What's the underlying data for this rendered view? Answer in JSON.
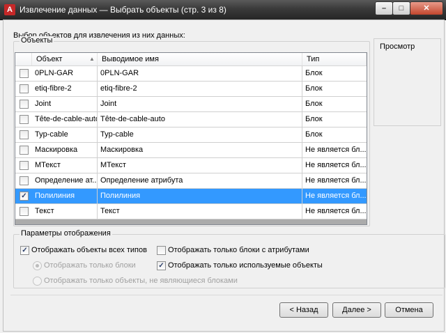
{
  "window": {
    "title": "Извлечение данных — Выбрать объекты (стр. 3 из 8)",
    "app_icon_letter": "A",
    "controls": {
      "minimize": "–",
      "maximize": "□",
      "close": "✕"
    }
  },
  "select_label": "Выбор объектов для извлечения из них данных:",
  "objects_group": "Объекты",
  "preview_label": "Просмотр",
  "table": {
    "columns": [
      "Объект",
      "Выводимое имя",
      "Тип"
    ],
    "sort_indicator": "▲",
    "rows": [
      {
        "checked": false,
        "object": "0PLN-GAR",
        "display": "0PLN-GAR",
        "type": "Блок"
      },
      {
        "checked": false,
        "object": "etiq-fibre-2",
        "display": "etiq-fibre-2",
        "type": "Блок"
      },
      {
        "checked": false,
        "object": "Joint",
        "display": "Joint",
        "type": "Блок"
      },
      {
        "checked": false,
        "object": "Tête-de-cable-auto",
        "display": "Tête-de-cable-auto",
        "type": "Блок"
      },
      {
        "checked": false,
        "object": "Typ-cable",
        "display": "Typ-cable",
        "type": "Блок"
      },
      {
        "checked": false,
        "object": "Маскировка",
        "display": "Маскировка",
        "type": "Не является бл..."
      },
      {
        "checked": false,
        "object": "МТекст",
        "display": "МТекст",
        "type": "Не является бл..."
      },
      {
        "checked": false,
        "object": "Определение ат...",
        "display": "Определение атрибута",
        "type": "Не является бл..."
      },
      {
        "checked": true,
        "selected": true,
        "object": "Полилиния",
        "display": "Полилиния",
        "type": "Не является бл..."
      },
      {
        "checked": false,
        "object": "Текст",
        "display": "Текст",
        "type": "Не является бл..."
      }
    ]
  },
  "display_options": {
    "title": "Параметры отображения",
    "show_all_types": {
      "label": "Отображать объекты всех типов",
      "checked": true
    },
    "only_blocks": {
      "label": "Отображать только блоки",
      "disabled": true
    },
    "only_non_blocks": {
      "label": "Отображать только объекты, не являющиеся блоками",
      "disabled": true
    },
    "only_blocks_with_attrs": {
      "label": "Отображать только блоки с атрибутами",
      "checked": false
    },
    "only_used": {
      "label": "Отображать только используемые объекты",
      "checked": true
    }
  },
  "buttons": {
    "back": "< Назад",
    "next": "Далее >",
    "cancel": "Отмена"
  },
  "check_glyph": "✓"
}
